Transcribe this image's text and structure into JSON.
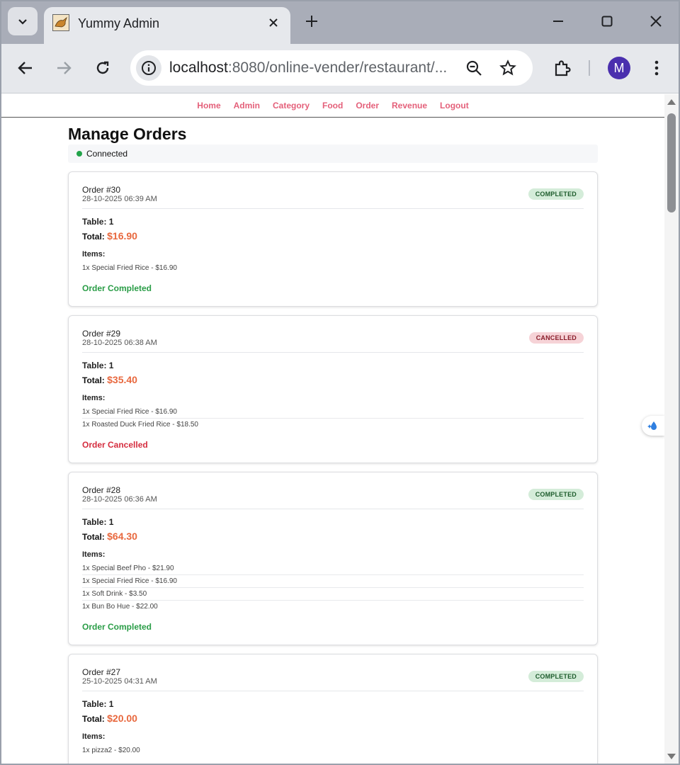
{
  "browser": {
    "tab_title": "Yummy Admin",
    "url_host": "localhost",
    "url_rest": ":8080/online-vender/restaurant/...",
    "profile_initial": "M"
  },
  "nav": [
    "Home",
    "Admin",
    "Category",
    "Food",
    "Order",
    "Revenue",
    "Logout"
  ],
  "page": {
    "title": "Manage Orders",
    "connection_status": "Connected"
  },
  "orders": [
    {
      "id": "Order #30",
      "date": "28-10-2025 06:39 AM",
      "badge": "COMPLETED",
      "table_label": "Table:",
      "table": "1",
      "total_label": "Total:",
      "total": "$16.90",
      "items_label": "Items:",
      "items": [
        "1x Special Fried Rice - $16.90"
      ],
      "status": "Order Completed"
    },
    {
      "id": "Order #29",
      "date": "28-10-2025 06:38 AM",
      "badge": "CANCELLED",
      "table_label": "Table:",
      "table": "1",
      "total_label": "Total:",
      "total": "$35.40",
      "items_label": "Items:",
      "items": [
        "1x Special Fried Rice - $16.90",
        "1x Roasted Duck Fried Rice - $18.50"
      ],
      "status": "Order Cancelled"
    },
    {
      "id": "Order #28",
      "date": "28-10-2025 06:36 AM",
      "badge": "COMPLETED",
      "table_label": "Table:",
      "table": "1",
      "total_label": "Total:",
      "total": "$64.30",
      "items_label": "Items:",
      "items": [
        "1x Special Beef Pho - $21.90",
        "1x Special Fried Rice - $16.90",
        "1x Soft Drink - $3.50",
        "1x Bun Bo Hue - $22.00"
      ],
      "status": "Order Completed"
    },
    {
      "id": "Order #27",
      "date": "25-10-2025 04:31 AM",
      "badge": "COMPLETED",
      "table_label": "Table:",
      "table": "1",
      "total_label": "Total:",
      "total": "$20.00",
      "items_label": "Items:",
      "items": [
        "1x pizza2 - $20.00"
      ],
      "status": ""
    }
  ],
  "colors": {
    "nav_link": "#e4607a",
    "total_amount": "#e8683e",
    "completed_text": "#2a9d47",
    "cancelled_text": "#d52d3f",
    "connected_dot": "#22a34a"
  }
}
